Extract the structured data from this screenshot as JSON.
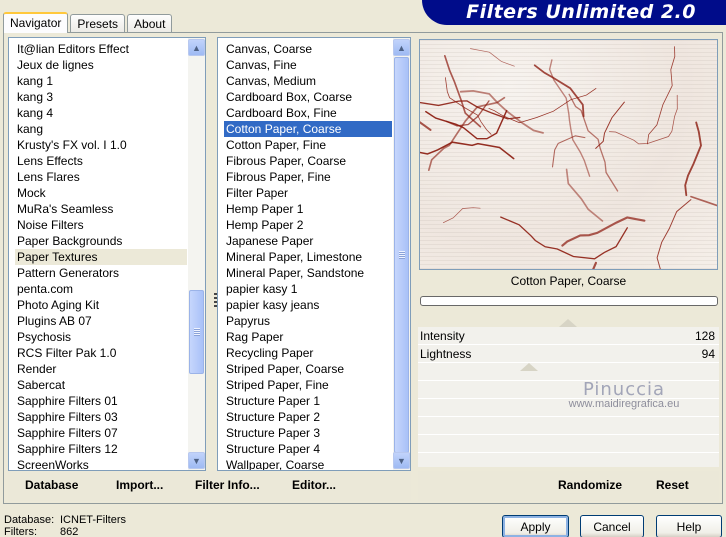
{
  "header": {
    "title": "Filters Unlimited 2.0"
  },
  "tabs": [
    {
      "label": "Navigator",
      "active": true
    },
    {
      "label": "Presets",
      "active": false
    },
    {
      "label": "About",
      "active": false
    }
  ],
  "categories": {
    "selected_index": 13,
    "items": [
      "It@lian Editors Effect",
      "Jeux de lignes",
      "kang 1",
      "kang 3",
      "kang 4",
      "kang",
      "Krusty's FX vol. I 1.0",
      "Lens Effects",
      "Lens Flares",
      "Mock",
      "MuRa's Seamless",
      "Noise Filters",
      "Paper Backgrounds",
      "Paper Textures",
      "Pattern Generators",
      "penta.com",
      "Photo Aging Kit",
      "Plugins AB 07",
      "Psychosis",
      "RCS Filter Pak 1.0",
      "Render",
      "Sabercat",
      "Sapphire Filters 01",
      "Sapphire Filters 03",
      "Sapphire Filters 07",
      "Sapphire Filters 12",
      "ScreenWorks"
    ]
  },
  "filters": {
    "selected_index": 5,
    "items": [
      "Canvas, Coarse",
      "Canvas, Fine",
      "Canvas, Medium",
      "Cardboard Box, Coarse",
      "Cardboard Box, Fine",
      "Cotton Paper, Coarse",
      "Cotton Paper, Fine",
      "Fibrous Paper, Coarse",
      "Fibrous Paper, Fine",
      "Filter Paper",
      "Hemp Paper 1",
      "Hemp Paper 2",
      "Japanese Paper",
      "Mineral Paper, Limestone",
      "Mineral Paper, Sandstone",
      "papier kasy 1",
      "papier kasy jeans",
      "Papyrus",
      "Rag Paper",
      "Recycling Paper",
      "Striped Paper, Coarse",
      "Striped Paper, Fine",
      "Structure Paper 1",
      "Structure Paper 2",
      "Structure Paper 3",
      "Structure Paper 4",
      "Wallpaper, Coarse"
    ]
  },
  "preview": {
    "filter_name": "Cotton Paper, Coarse",
    "crack_color": "#8b1a0e"
  },
  "params": [
    {
      "label": "Intensity",
      "value": 128,
      "max": 255
    },
    {
      "label": "Lightness",
      "value": 94,
      "max": 255
    }
  ],
  "watermark": {
    "name": "Pinuccia",
    "url": "www.maidiregrafica.eu"
  },
  "toolbar": {
    "database": "Database",
    "import": "Import...",
    "filter_info": "Filter Info...",
    "editor": "Editor...",
    "randomize": "Randomize",
    "reset": "Reset"
  },
  "status": {
    "database_label": "Database:",
    "database_value": "ICNET-Filters",
    "filters_label": "Filters:",
    "filters_value": "862"
  },
  "buttons": {
    "apply": "Apply",
    "cancel": "Cancel",
    "help": "Help"
  }
}
